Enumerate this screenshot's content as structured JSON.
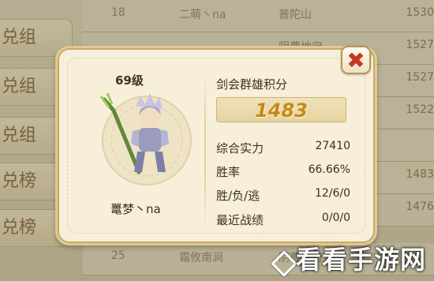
{
  "background": {
    "left_tabs": [
      {
        "label": "兑组",
        "chevron": false
      },
      {
        "label": "兑组",
        "chevron": false
      },
      {
        "label": "兑组",
        "chevron": false
      },
      {
        "label": "兑榜",
        "chevron": true
      },
      {
        "label": "兑榜",
        "chevron": true
      }
    ],
    "rows": [
      {
        "rank": "18",
        "name": "二萌丶na",
        "place": "普陀山",
        "score": "1530"
      },
      {
        "rank": "",
        "name": "",
        "place": "阴曹地府",
        "score": "1527"
      },
      {
        "rank": "",
        "name": "",
        "place": "",
        "score": "1527"
      },
      {
        "rank": "",
        "name": "",
        "place": "",
        "score": "1522"
      },
      {
        "rank": "",
        "name": "",
        "place": "",
        "score": ""
      },
      {
        "rank": "",
        "name": "",
        "place": "",
        "score": "1483"
      },
      {
        "rank": "",
        "name": "",
        "place": "",
        "score": "1476"
      },
      {
        "rank": "25",
        "name": "霜攸南涧",
        "place": "阴曹地府",
        "score": ""
      }
    ]
  },
  "dialog": {
    "level": "69级",
    "character_name": "鼍梦丶na",
    "section_title": "剑会群雄积分",
    "score": "1483",
    "close_icon": "close-icon",
    "stats": [
      {
        "label": "综合实力",
        "value": "27410"
      },
      {
        "label": "胜率",
        "value": "66.66%"
      },
      {
        "label": "胜/负/逃",
        "value": "12/6/0"
      },
      {
        "label": "最近战绩",
        "value": "0/0/0"
      }
    ]
  },
  "watermark": "看看手游网",
  "colors": {
    "score": "#c58a19",
    "close": "#c63722",
    "panel": "#f7efd9"
  }
}
